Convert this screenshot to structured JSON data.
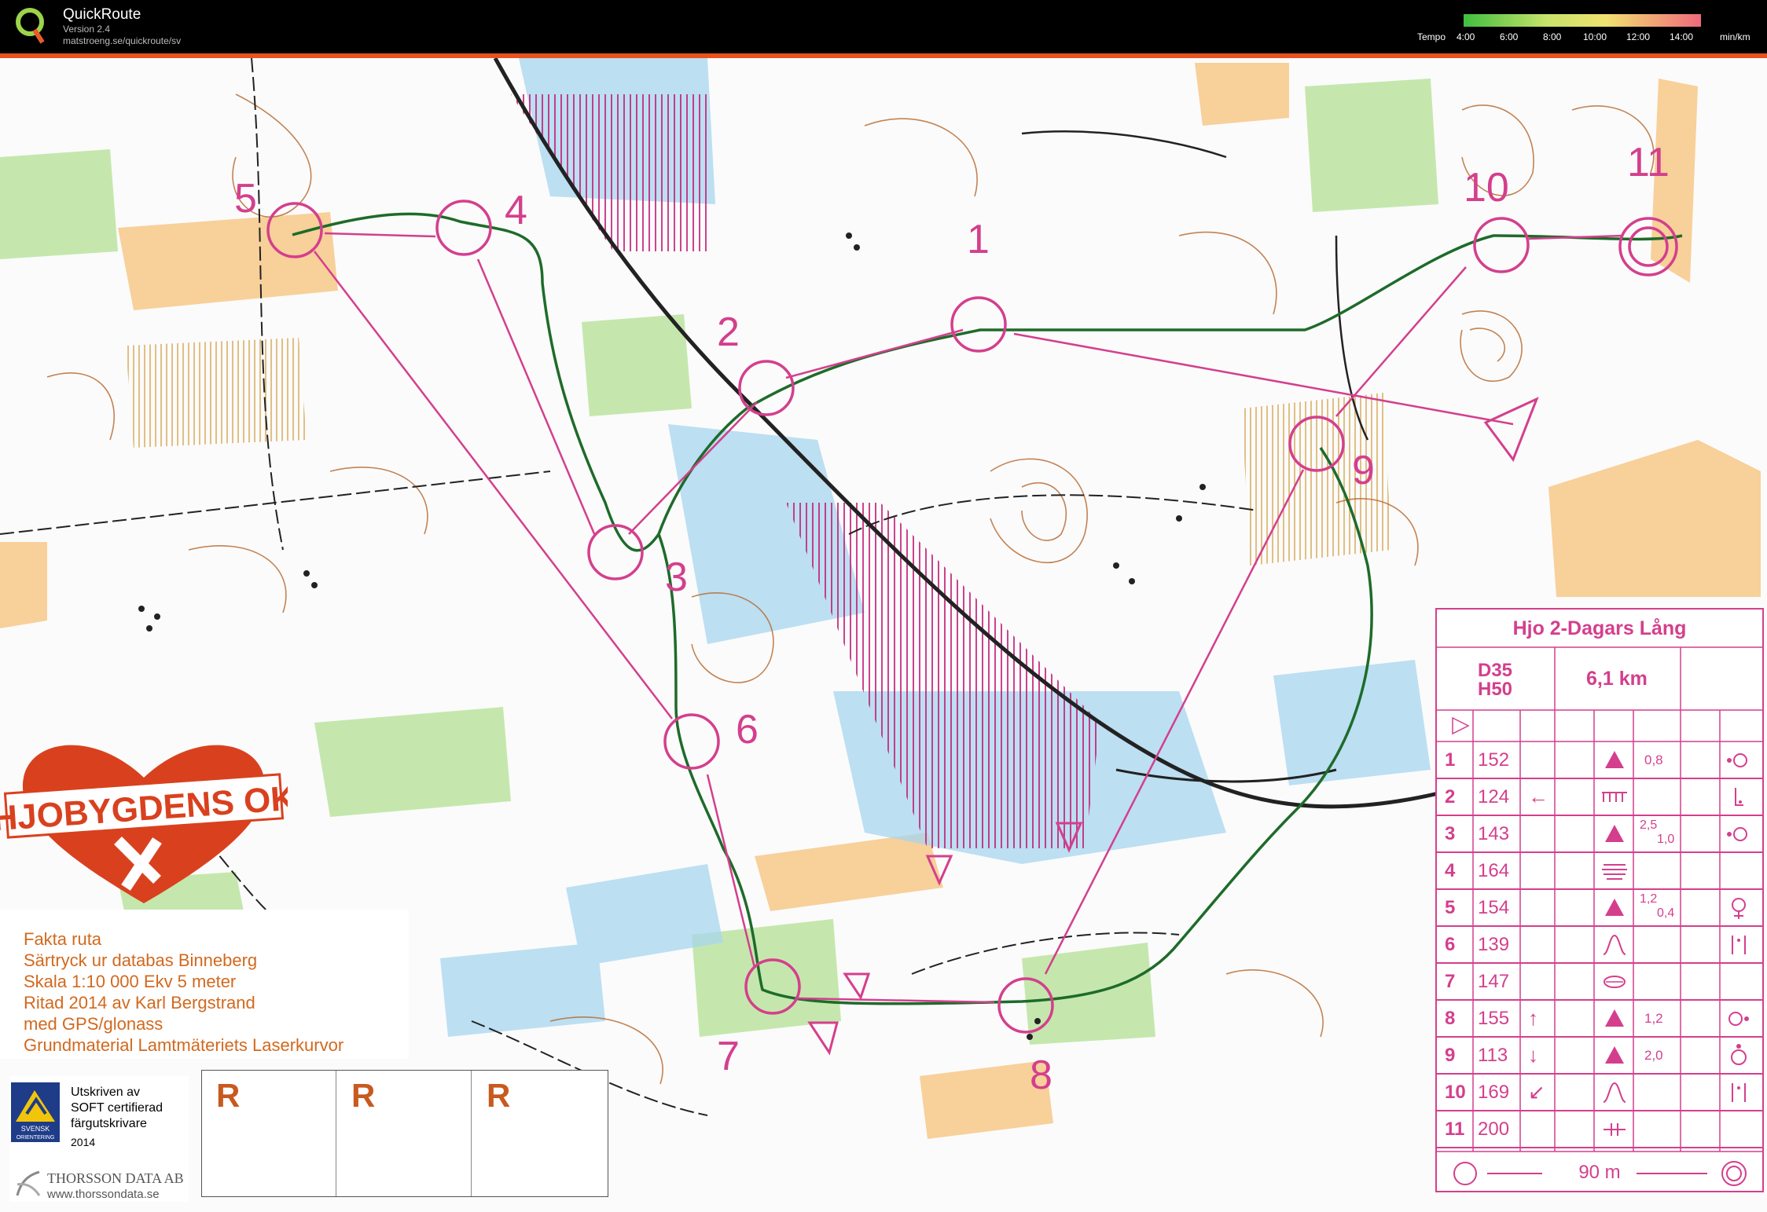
{
  "app": {
    "name": "QuickRoute",
    "version": "Version 2.4",
    "url": "matstroeng.se/quickroute/sv"
  },
  "tempo": {
    "label": "Tempo",
    "ticks": [
      "4:00",
      "6:00",
      "8:00",
      "10:00",
      "12:00",
      "14:00"
    ],
    "unit": "min/km"
  },
  "colors": {
    "course": "#d43f8d",
    "route": "#1e6b2a",
    "forest": "#ffffff",
    "open": "#f7b24a",
    "green": "#8fcf6e",
    "water": "#7ec3e6",
    "contour": "#b5652b"
  },
  "controls": [
    {
      "label": "1"
    },
    {
      "label": "2"
    },
    {
      "label": "3"
    },
    {
      "label": "4"
    },
    {
      "label": "5"
    },
    {
      "label": "6"
    },
    {
      "label": "7"
    },
    {
      "label": "8"
    },
    {
      "label": "9"
    },
    {
      "label": "10"
    },
    {
      "label": "11"
    }
  ],
  "club": {
    "name": "HJOBYGDENS OK"
  },
  "fakta": {
    "lines": [
      "Fakta ruta",
      "Särtryck ur databas Binneberg",
      "Skala 1:10 000  Ekv 5 meter",
      "Ritad 2014 av Karl Bergstrand",
      "med GPS/glonass",
      "Grundmaterial Lamtmäteriets Laserkurvor"
    ]
  },
  "soft": {
    "lines": [
      "Utskriven av",
      "SOFT certifierad",
      "färgutskrivare"
    ],
    "year": "2014",
    "badge": [
      "SVENSK",
      "ORIENTERING"
    ]
  },
  "thorsson": {
    "name": "THORSSON DATA AB",
    "url": "www.thorssondata.se"
  },
  "r_boxes": [
    "R",
    "R",
    "R"
  ],
  "description": {
    "title": "Hjo 2-Dagars Lång",
    "classes": [
      "D35",
      "H50"
    ],
    "length": "6,1 km",
    "rows": [
      {
        "n": "1",
        "code": "152",
        "dir": "",
        "feature": "triangle",
        "value": "0,8",
        "value2": "",
        "pos": "dot-circle"
      },
      {
        "n": "2",
        "code": "124",
        "dir": "←",
        "feature": "ditch",
        "value": "",
        "value2": "",
        "pos": "corner"
      },
      {
        "n": "3",
        "code": "143",
        "dir": "",
        "feature": "triangle",
        "value": "2,5",
        "value2": "1,0",
        "pos": "dot-circle"
      },
      {
        "n": "4",
        "code": "164",
        "dir": "",
        "feature": "marsh",
        "value": "",
        "value2": "",
        "pos": ""
      },
      {
        "n": "5",
        "code": "154",
        "dir": "",
        "feature": "triangle",
        "value": "1,2",
        "value2": "0,4",
        "pos": "foot"
      },
      {
        "n": "6",
        "code": "139",
        "dir": "",
        "feature": "hill",
        "value": "",
        "value2": "",
        "pos": "between"
      },
      {
        "n": "7",
        "code": "147",
        "dir": "",
        "feature": "knoll",
        "value": "",
        "value2": "",
        "pos": ""
      },
      {
        "n": "8",
        "code": "155",
        "dir": "↑",
        "feature": "triangle",
        "value": "1,2",
        "value2": "",
        "pos": "dot-circle-r"
      },
      {
        "n": "9",
        "code": "113",
        "dir": "↓",
        "feature": "triangle",
        "value": "2,0",
        "value2": "",
        "pos": "top"
      },
      {
        "n": "10",
        "code": "169",
        "dir": "↙",
        "feature": "hill",
        "value": "",
        "value2": "",
        "pos": "between"
      },
      {
        "n": "11",
        "code": "200",
        "dir": "",
        "feature": "gap",
        "value": "",
        "value2": "",
        "pos": ""
      }
    ],
    "finish": "90 m"
  }
}
